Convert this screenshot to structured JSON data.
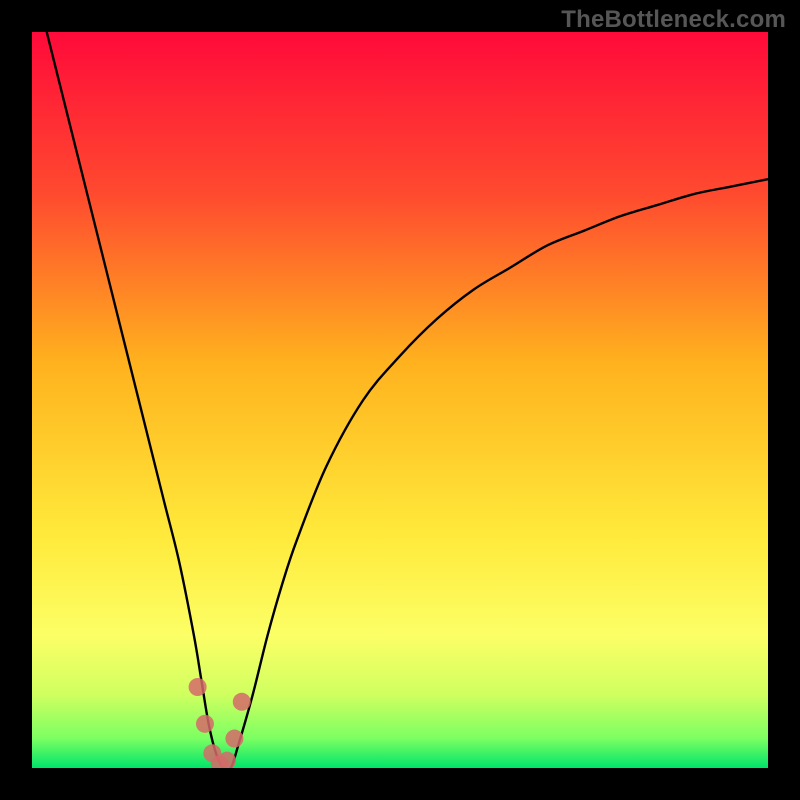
{
  "watermark": "TheBottleneck.com",
  "colors": {
    "frame": "#000000",
    "gradient_top": "#ff0a3a",
    "gradient_mid1": "#ff682a",
    "gradient_mid2": "#ffd21a",
    "gradient_mid3": "#fffb5a",
    "gradient_mid4": "#b6ff5a",
    "gradient_bottom": "#00e46a",
    "curve": "#000000",
    "marker": "#d56a6a"
  },
  "chart_data": {
    "type": "line",
    "title": "",
    "xlabel": "",
    "ylabel": "",
    "xlim": [
      0,
      100
    ],
    "ylim": [
      0,
      100
    ],
    "series": [
      {
        "name": "curve",
        "x": [
          2,
          4,
          6,
          8,
          10,
          12,
          14,
          16,
          18,
          20,
          22,
          23,
          24,
          25,
          26,
          27,
          28,
          30,
          32,
          34,
          36,
          40,
          45,
          50,
          55,
          60,
          65,
          70,
          75,
          80,
          85,
          90,
          95,
          100
        ],
        "values": [
          100,
          92,
          84,
          76,
          68,
          60,
          52,
          44,
          36,
          28,
          18,
          12,
          6,
          2,
          0,
          0,
          3,
          10,
          18,
          25,
          31,
          41,
          50,
          56,
          61,
          65,
          68,
          71,
          73,
          75,
          76.5,
          78,
          79,
          80
        ]
      }
    ],
    "markers": [
      {
        "x": 22.5,
        "y": 11
      },
      {
        "x": 23.5,
        "y": 6
      },
      {
        "x": 24.5,
        "y": 2
      },
      {
        "x": 25.5,
        "y": 0.5
      },
      {
        "x": 26.5,
        "y": 1
      },
      {
        "x": 27.5,
        "y": 4
      },
      {
        "x": 28.5,
        "y": 9
      }
    ],
    "legend": false,
    "grid": false
  }
}
